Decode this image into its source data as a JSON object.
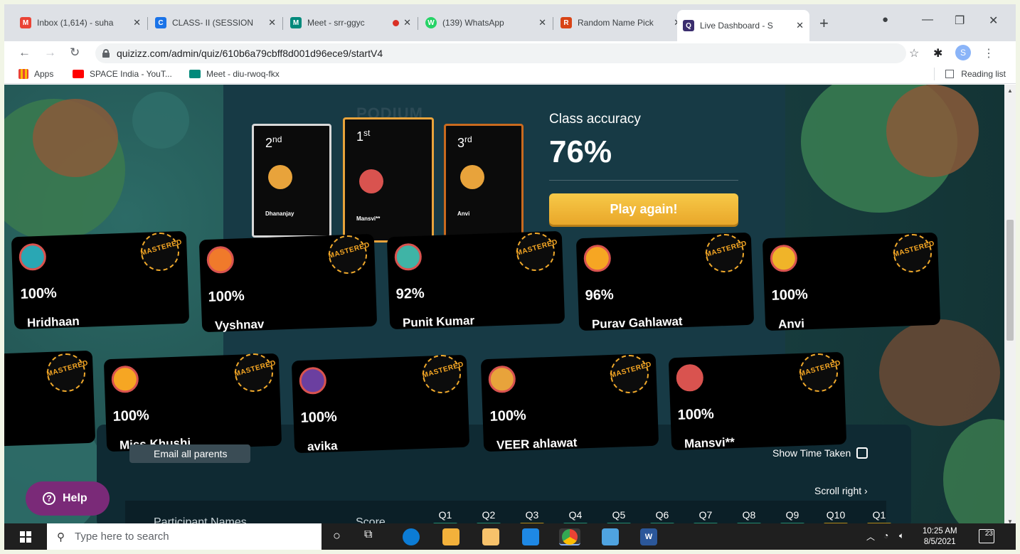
{
  "tabs": [
    {
      "title": "Inbox (1,614) - suha",
      "icon": "gmail-icon",
      "color": "#ea4335",
      "letter": "M"
    },
    {
      "title": "CLASS- II (SESSION",
      "icon": "classroom-icon",
      "color": "#1a73e8",
      "letter": "C"
    },
    {
      "title": "Meet - srr-ggyc",
      "icon": "meet-icon",
      "color": "#00897b",
      "letter": "M"
    },
    {
      "title": "(139) WhatsApp",
      "icon": "whatsapp-icon",
      "color": "#25d366",
      "letter": "W"
    },
    {
      "title": "Random Name Pick",
      "icon": "random-picker-icon",
      "color": "#d84315",
      "letter": "R"
    },
    {
      "title": "Live Dashboard - S",
      "icon": "quizizz-icon",
      "color": "#3b2e6e",
      "letter": "Q"
    }
  ],
  "address_bar": {
    "url": "quizizz.com/admin/quiz/610b6a79cbff8d001d96ece9/startV4",
    "profile_initial": "S"
  },
  "bookmarks": [
    {
      "label": "Apps",
      "icon": "apps-grid-icon",
      "color": "#ea4335"
    },
    {
      "label": "SPACE India - YouT...",
      "icon": "youtube-icon",
      "color": "#ff0000"
    },
    {
      "label": "Meet - diu-rwoq-fkx",
      "icon": "meet-icon",
      "color": "#00897b"
    }
  ],
  "reading_list": "Reading list",
  "podium": {
    "title": "PODIUM",
    "entries": [
      {
        "rank": "2",
        "suffix": "nd",
        "name": "Dhananjay",
        "border": "#d9d9d9",
        "avatar_color": "#e8a33b"
      },
      {
        "rank": "1",
        "suffix": "st",
        "name": "Mansvi**",
        "border": "#e8a33b",
        "avatar_color": "#d9534f"
      },
      {
        "rank": "3",
        "suffix": "rd",
        "name": "Anvi",
        "border": "#c96a1f",
        "avatar_color": "#e8a33b"
      }
    ]
  },
  "accuracy": {
    "label": "Class accuracy",
    "value": "76%"
  },
  "play_again": "Play again!",
  "badge_text": "MASTERED",
  "participants_row1": [
    {
      "name": "Hridhaan",
      "score": "100%",
      "avatar_color": "#2aa7b4"
    },
    {
      "name": "Vyshnav",
      "score": "100%",
      "avatar_color": "#f07a2b"
    },
    {
      "name": "Punit Kumar",
      "score": "92%",
      "avatar_color": "#3fb4a6"
    },
    {
      "name": "Purav Gahlawat",
      "score": "96%",
      "avatar_color": "#f6a623"
    },
    {
      "name": "Anvi",
      "score": "100%",
      "avatar_color": "#f0b429"
    }
  ],
  "participants_row2": [
    {
      "name": "Miss Khushi",
      "score": "100%",
      "avatar_color": "#f6a623"
    },
    {
      "name": "avika",
      "score": "100%",
      "avatar_color": "#6b3fa0"
    },
    {
      "name": "VEER ahlawat",
      "score": "100%",
      "avatar_color": "#e8a33b"
    },
    {
      "name": "Mansvi**",
      "score": "100%",
      "avatar_color": "#d9534f"
    }
  ],
  "lower": {
    "email_parents": "Email all parents",
    "show_time": "Show Time Taken",
    "scroll_right": "Scroll right",
    "participant_names": "Participant Names",
    "score": "Score",
    "questions": [
      "Q1",
      "Q2",
      "Q3",
      "Q4",
      "Q5",
      "Q6",
      "Q7",
      "Q8",
      "Q9",
      "Q10",
      "Q1"
    ],
    "question_colors": [
      "#1f8a70",
      "#1f8a70",
      "#b08a1a",
      "#1f8a70",
      "#1f8a70",
      "#1f8a70",
      "#1f8a70",
      "#1f8a70",
      "#1f8a70",
      "#b08a1a",
      "#b08a1a"
    ]
  },
  "help": "Help",
  "taskbar": {
    "search_placeholder": "Type here to search",
    "time": "10:25 AM",
    "date": "8/5/2021",
    "notifications": "23"
  }
}
